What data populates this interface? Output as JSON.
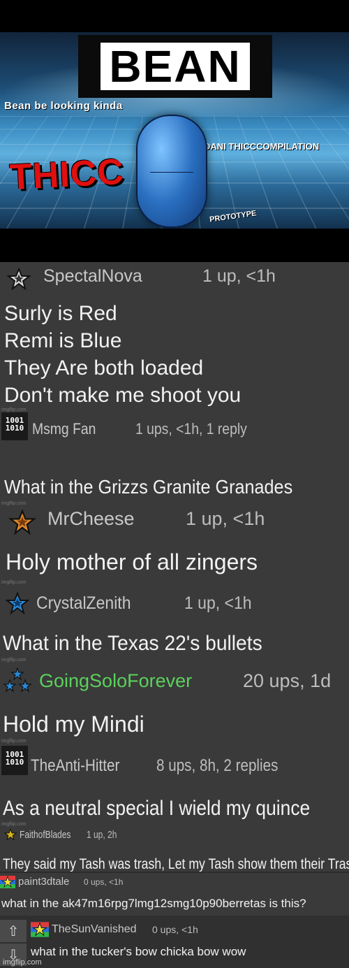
{
  "banner": {
    "title": "BEAN",
    "subtitle": "Bean be looking kinda",
    "thicc": "THICC",
    "compilation_prefix": "DANI",
    "compilation_bold": "THICC",
    "compilation_suffix": "COMPILATION",
    "proto": "PROTOTYPE"
  },
  "comments": [
    {
      "user": "SpectalNova",
      "meta": "1 up, <1h",
      "lines": [
        "Surly is Red",
        "Remi is Blue",
        "They Are both loaded",
        "Don't make me shoot you"
      ]
    },
    {
      "user": "Msmg Fan",
      "meta": "1 ups, <1h, 1 reply",
      "text": "What in the Grizzs Granite Granades"
    },
    {
      "user": "MrCheese",
      "meta": "1 up, <1h",
      "text": "Holy mother of all zingers"
    },
    {
      "user": "CrystalZenith",
      "meta": "1 up, <1h",
      "text": "What in the Texas 22's bullets"
    },
    {
      "user": "GoingSoloForever",
      "meta": "20 ups, 1d",
      "text": "Hold my Mindi"
    },
    {
      "user": "TheAnti-Hitter",
      "meta": "8 ups, 8h, 2 replies",
      "text": "As a neutral special I wield my quince"
    },
    {
      "user": "FaithofBlades",
      "meta": "1 up, 2h",
      "text": "They said my Tash was trash, Let my Tash show them their Trash"
    },
    {
      "user": "paint3dtale",
      "meta": "0 ups, <1h",
      "text": "what in the ak47m16rpg7lmg12smg10p90berretas is this?"
    },
    {
      "user": "TheSunVanished",
      "meta": "0 ups, <1h",
      "text": "what in the tucker's bow chicka bow wow"
    }
  ],
  "tiny_mark": "imgflip.com",
  "binary_avatar": {
    "row1": "1001",
    "row2": "1010"
  },
  "vote": {
    "up": "⇧",
    "down": "⇩"
  },
  "watermark": "imgflip.com",
  "colors": {
    "background": "#3a3a3a",
    "highlight_user": "#5bd15b"
  }
}
